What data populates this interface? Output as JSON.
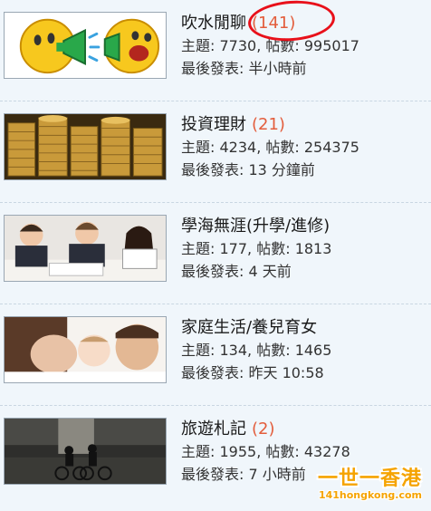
{
  "forums": [
    {
      "title": "吹水閒聊",
      "today_count": "(141)",
      "topics_label": "主題: ",
      "topics": "7730",
      "posts_label": ", 帖數: ",
      "posts": "995017",
      "last_post_label": "最後發表: ",
      "last_post": "半小時前",
      "thumbnail": "emoticons-shouting-megaphone-image"
    },
    {
      "title": "投資理財",
      "today_count": "(21)",
      "topics_label": "主題: ",
      "topics": "4234",
      "posts_label": ", 帖數: ",
      "posts": "254375",
      "last_post_label": "最後發表: ",
      "last_post": "13 分鐘前",
      "thumbnail": "gold-coin-stacks-image"
    },
    {
      "title": "學海無涯(升學/進修)",
      "today_count": "",
      "topics_label": "主題: ",
      "topics": "177",
      "posts_label": ", 帖數: ",
      "posts": "1813",
      "last_post_label": "最後發表: ",
      "last_post": "4 天前",
      "thumbnail": "children-studying-image"
    },
    {
      "title": "家庭生活/養兒育女",
      "today_count": "",
      "topics_label": "主題: ",
      "topics": "134",
      "posts_label": ", 帖數: ",
      "posts": "1465",
      "last_post_label": "最後發表: ",
      "last_post": "昨天 10:58",
      "thumbnail": "family-with-baby-image"
    },
    {
      "title": "旅遊札記",
      "today_count": "(2)",
      "topics_label": "主題: ",
      "topics": "1955",
      "posts_label": ", 帖數: ",
      "posts": "43278",
      "last_post_label": "最後發表: ",
      "last_post": "7 小時前",
      "thumbnail": "street-cyclists-image"
    }
  ],
  "watermark": {
    "main": "一世一香港",
    "url": "141hongkong.com"
  },
  "colors": {
    "background": "#f0f6fb",
    "count": "#e35d3c",
    "annotation": "#e8101a",
    "watermark": "#f5a300"
  }
}
